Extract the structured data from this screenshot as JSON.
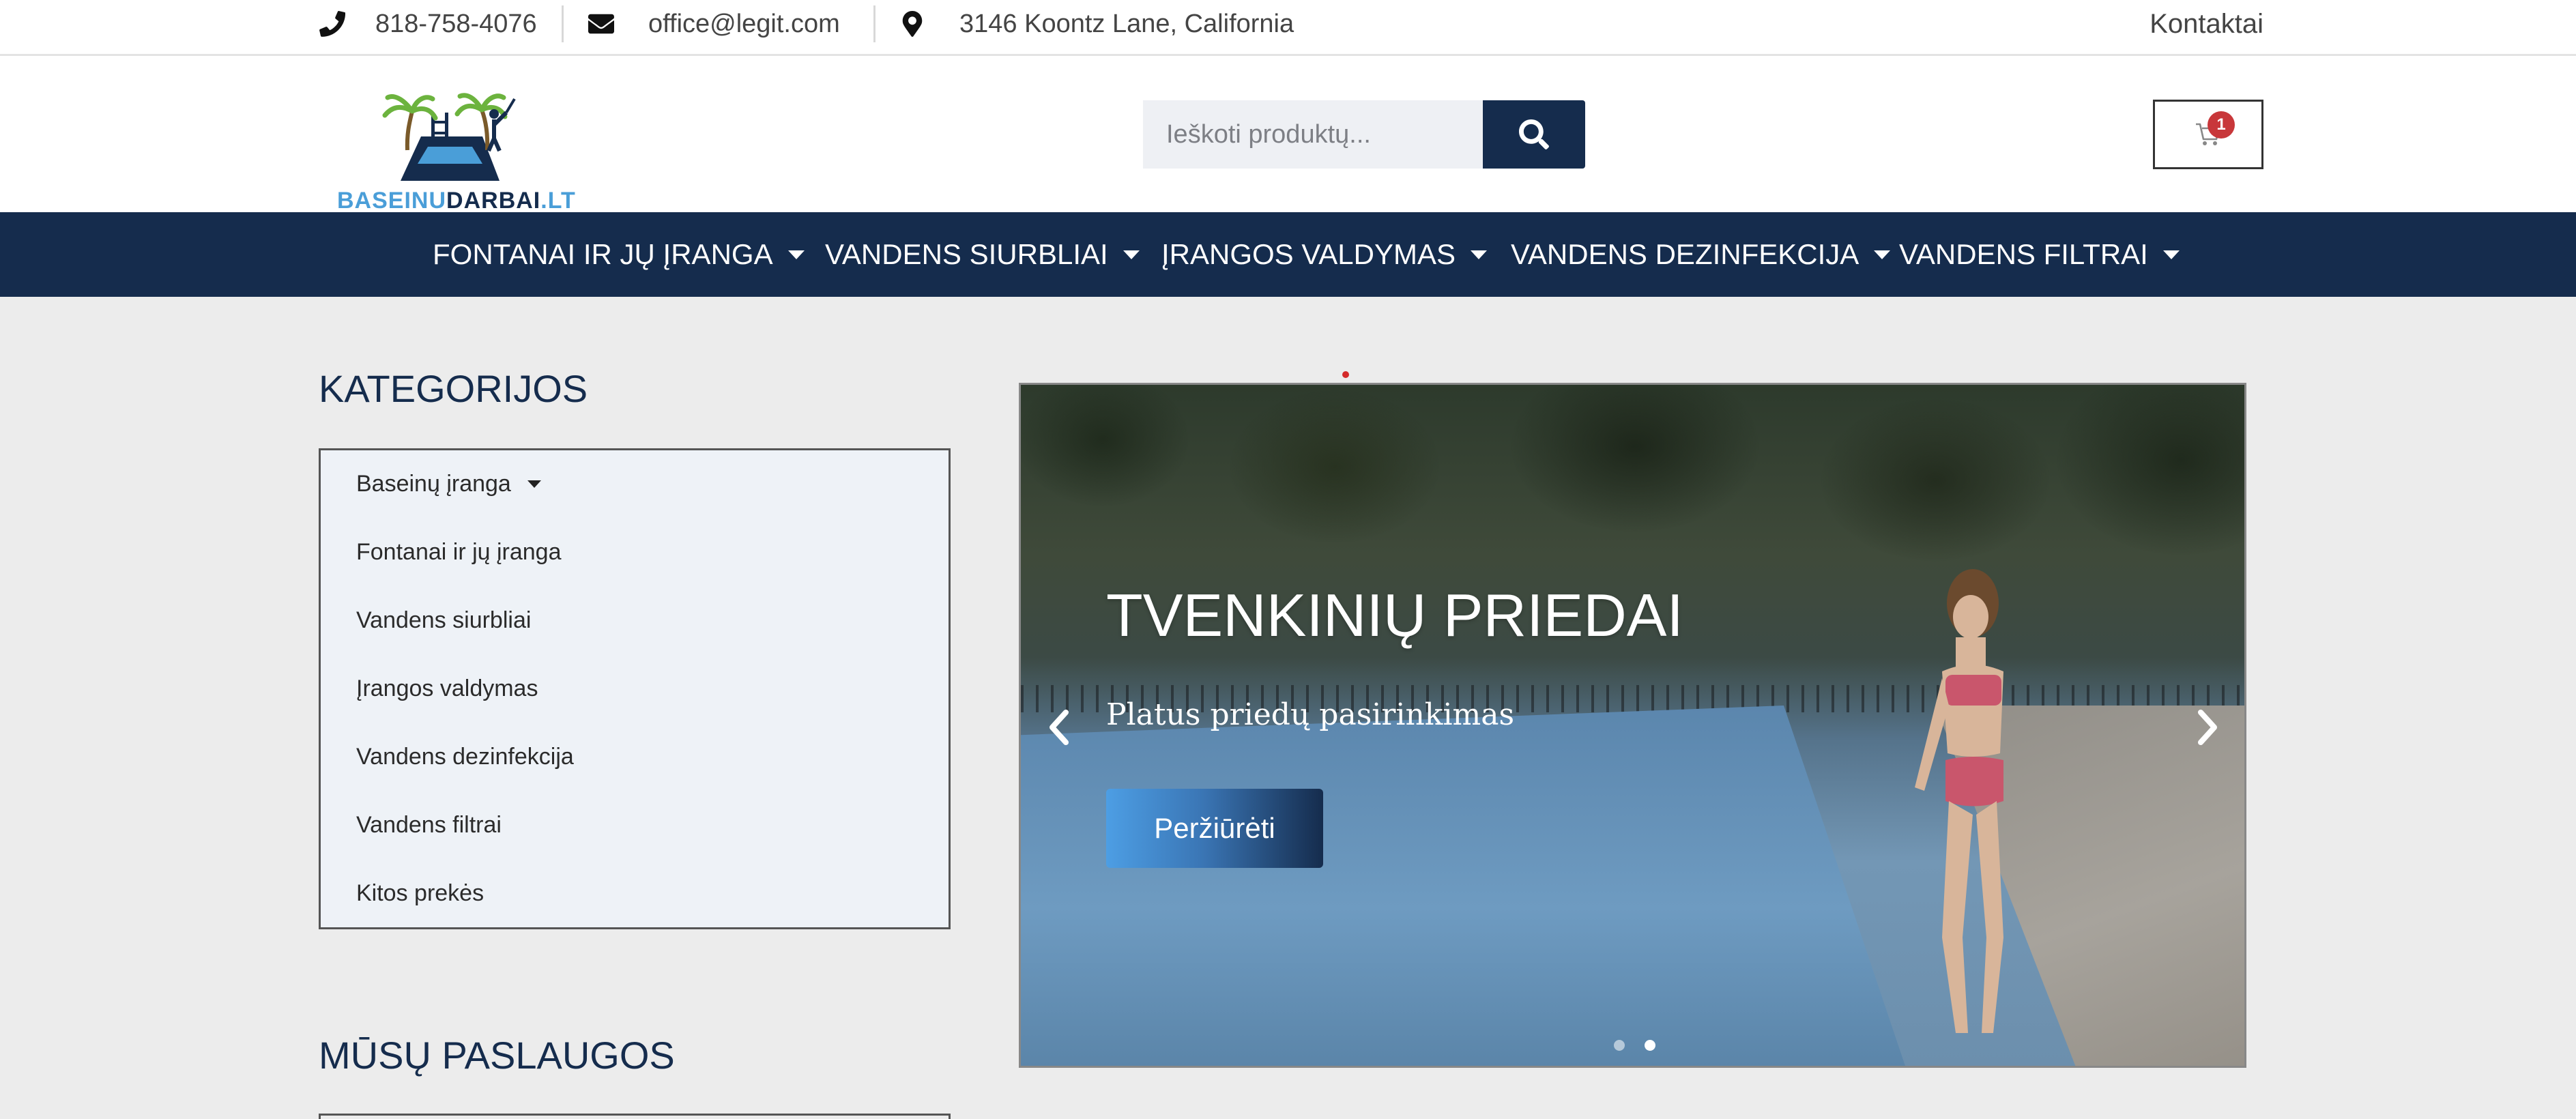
{
  "topbar": {
    "phone": "818-758-4076",
    "email": "office@legit.com",
    "address": "3146 Koontz Lane, California",
    "contact_link": "Kontaktai",
    "icons": [
      "phone-icon",
      "envelope-icon",
      "map-marker-icon"
    ]
  },
  "header": {
    "logo": {
      "part1": "BASEINU",
      "part2": "DARBAI",
      "part3": ".LT"
    },
    "search": {
      "placeholder": "Ieškoti produktų..."
    },
    "cart": {
      "count": "1"
    }
  },
  "nav": {
    "items": [
      {
        "label": "FONTANAI IR JŲ ĮRANGA"
      },
      {
        "label": "VANDENS SIURBLIAI"
      },
      {
        "label": "ĮRANGOS VALDYMAS"
      },
      {
        "label": "VANDENS DEZINFEKCIJA"
      },
      {
        "label": "VANDENS FILTRAI"
      }
    ]
  },
  "sidebar": {
    "categories_heading": "KATEGORIJOS",
    "categories": [
      {
        "label": "Baseinų įranga"
      },
      {
        "label": "Fontanai ir jų įranga"
      },
      {
        "label": "Vandens siurbliai"
      },
      {
        "label": "Įrangos valdymas"
      },
      {
        "label": "Vandens dezinfekcija"
      },
      {
        "label": "Vandens filtrai"
      },
      {
        "label": "Kitos prekės"
      }
    ],
    "services_heading": "MŪSŲ PASLAUGOS"
  },
  "hero": {
    "title": "TVENKINIŲ PRIEDAI",
    "subtitle": "Platus priedų pasirinkimas",
    "button": "Peržiūrėti",
    "slides_total": 2,
    "active_slide": 2
  },
  "colors": {
    "brand_navy": "#152c4d",
    "brand_light_blue": "#4a9ed8",
    "badge_red": "#c8373a"
  }
}
